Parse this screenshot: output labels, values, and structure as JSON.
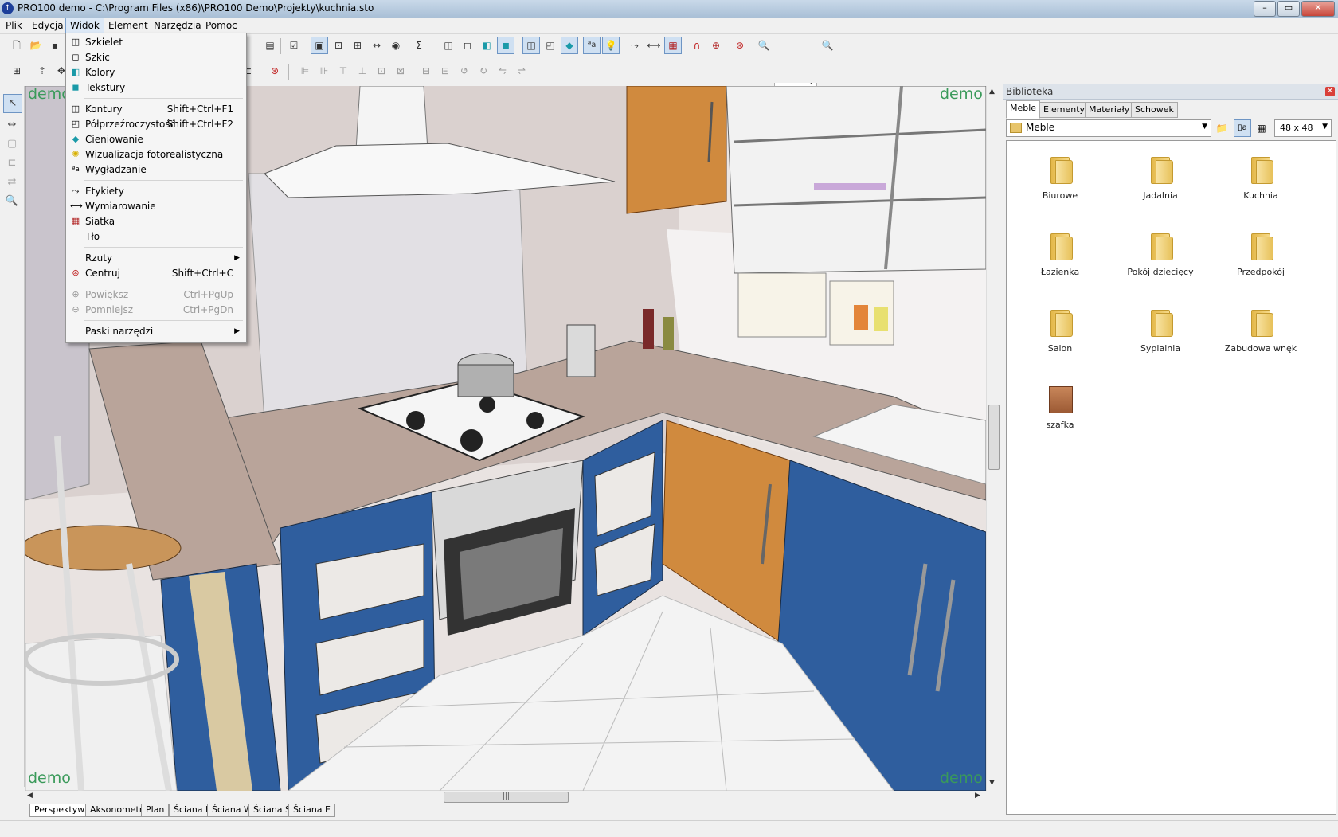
{
  "window": {
    "title": "PRO100 demo - C:\\Program Files (x86)\\PRO100 Demo\\Projekty\\kuchnia.sto",
    "buttons": [
      "minimize",
      "maximize",
      "close"
    ]
  },
  "menubar": {
    "items": [
      "Plik",
      "Edycja",
      "Widok",
      "Element",
      "Narzędzia",
      "Pomoc"
    ],
    "active": "Widok"
  },
  "widok_menu": {
    "items": [
      {
        "label": "Szkielet",
        "shortcut": "",
        "icon": "wireframe-icon"
      },
      {
        "label": "Szkic",
        "shortcut": "",
        "icon": "sketch-icon"
      },
      {
        "label": "Kolory",
        "shortcut": "",
        "icon": "colors-icon"
      },
      {
        "label": "Tekstury",
        "shortcut": "",
        "icon": "textures-icon"
      },
      {
        "label": "Kontury",
        "shortcut": "Shift+Ctrl+F1",
        "icon": "contours-icon"
      },
      {
        "label": "Półprzeźroczystość",
        "shortcut": "Shift+Ctrl+F2",
        "icon": "transparency-icon"
      },
      {
        "label": "Cieniowanie",
        "shortcut": "",
        "icon": "shading-icon"
      },
      {
        "label": "Wizualizacja fotorealistyczna",
        "shortcut": "",
        "icon": "lightbulb-icon"
      },
      {
        "label": "Wygładzanie",
        "shortcut": "",
        "icon": "antialias-icon"
      },
      {
        "label": "Etykiety",
        "shortcut": "",
        "icon": "labels-icon"
      },
      {
        "label": "Wymiarowanie",
        "shortcut": "",
        "icon": "dimensions-icon"
      },
      {
        "label": "Siatka",
        "shortcut": "",
        "icon": "grid-icon"
      },
      {
        "label": "Tło",
        "shortcut": "",
        "icon": ""
      },
      {
        "label": "Rzuty",
        "shortcut": "",
        "icon": ""
      },
      {
        "label": "Centruj",
        "shortcut": "Shift+Ctrl+C",
        "icon": "center-icon"
      },
      {
        "label": "Powiększ",
        "shortcut": "Ctrl+PgUp",
        "icon": "zoom-in-icon"
      },
      {
        "label": "Pomniejsz",
        "shortcut": "Ctrl+PgDn",
        "icon": "zoom-out-icon"
      },
      {
        "label": "Paski narzędzi",
        "shortcut": "",
        "icon": ""
      }
    ]
  },
  "viewport": {
    "watermark": "demo"
  },
  "view_tabs": [
    "Perspektywa",
    "Aksonometria",
    "Plan",
    "Ściana N",
    "Ściana W",
    "Ściana S",
    "Ściana E"
  ],
  "library": {
    "title": "Biblioteka",
    "tabs": [
      "Meble",
      "Elementy",
      "Materiały",
      "Schowek"
    ],
    "active_tab": "Meble",
    "folder": "Meble",
    "icon_size": "48 x  48",
    "items": [
      "Biurowe",
      "Jadalnia",
      "Kuchnia",
      "Łazienka",
      "Pokój dziecięcy",
      "Przedpokój",
      "Salon",
      "Sypialnia",
      "Zabudowa wnęk",
      "szafka"
    ]
  },
  "colors": {
    "cabinet_blue": "#2f5e9e",
    "wood_orange": "#d08a3e",
    "countertop": "#b9a49a",
    "watermark_green": "#3a9a5a"
  }
}
